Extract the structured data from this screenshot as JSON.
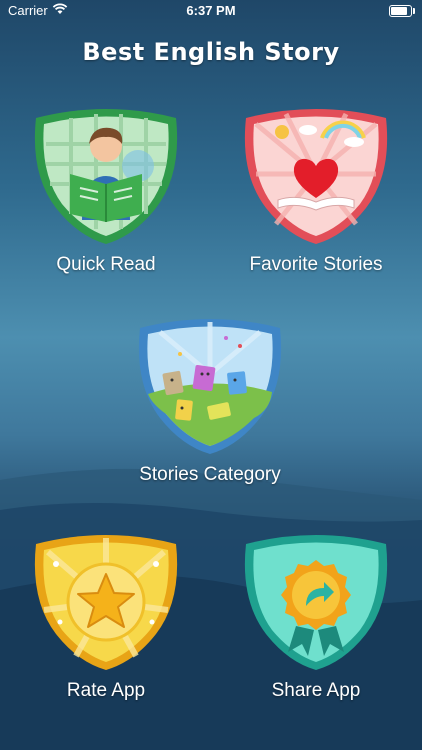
{
  "status_bar": {
    "carrier": "Carrier",
    "time": "6:37 PM",
    "battery_level": 0.95
  },
  "app": {
    "title": "Best English Story"
  },
  "menu": {
    "quick_read": "Quick Read",
    "favorite_stories": "Favorite Stories",
    "stories_category": "Stories Category",
    "rate_app": "Rate App",
    "share_app": "Share App"
  },
  "colors": {
    "quick_read_shield": "#6fc27a",
    "favorite_shield": "#f07f80",
    "category_shield": "#7fb8e6",
    "rate_shield": "#f5c52e",
    "share_shield": "#4fcdb9"
  }
}
